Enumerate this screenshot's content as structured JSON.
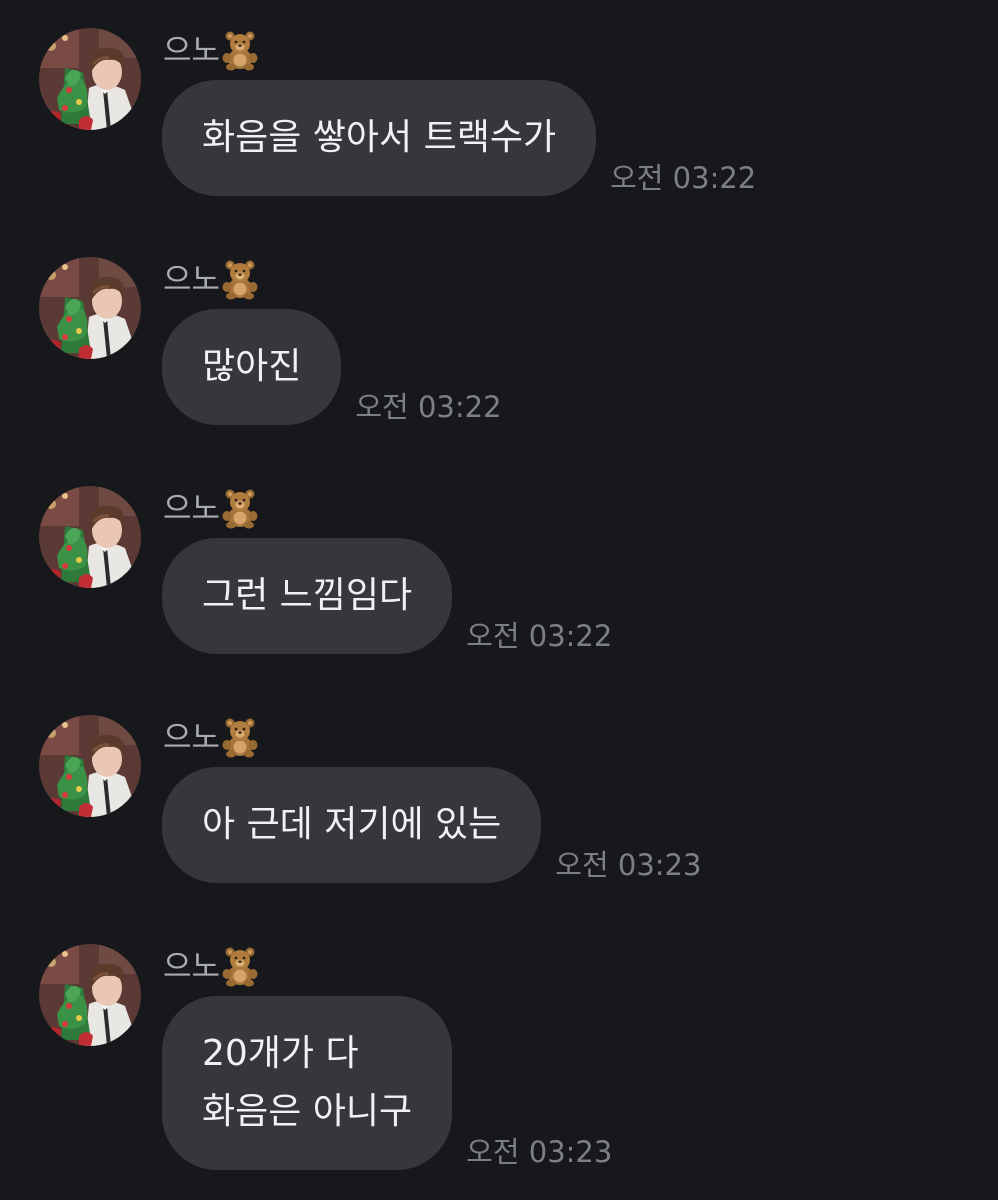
{
  "messages": [
    {
      "sender": "으노",
      "sender_emoji": "bear-icon",
      "text": "화음을 쌓아서 트랙수가",
      "time": "오전 03:22"
    },
    {
      "sender": "으노",
      "sender_emoji": "bear-icon",
      "text": "많아진",
      "time": "오전 03:22"
    },
    {
      "sender": "으노",
      "sender_emoji": "bear-icon",
      "text": "그런 느낌임다",
      "time": "오전 03:22"
    },
    {
      "sender": "으노",
      "sender_emoji": "bear-icon",
      "text": "아 근데 저기에 있는",
      "time": "오전 03:23"
    },
    {
      "sender": "으노",
      "sender_emoji": "bear-icon",
      "text": "20개가 다\n화음은 아니구",
      "time": "오전 03:23"
    }
  ],
  "colors": {
    "background": "#17181c",
    "bubble": "#36373d",
    "bubble_text": "#f1f1f3",
    "sender_text": "#a9abb2",
    "time_text": "#7d7f86"
  }
}
